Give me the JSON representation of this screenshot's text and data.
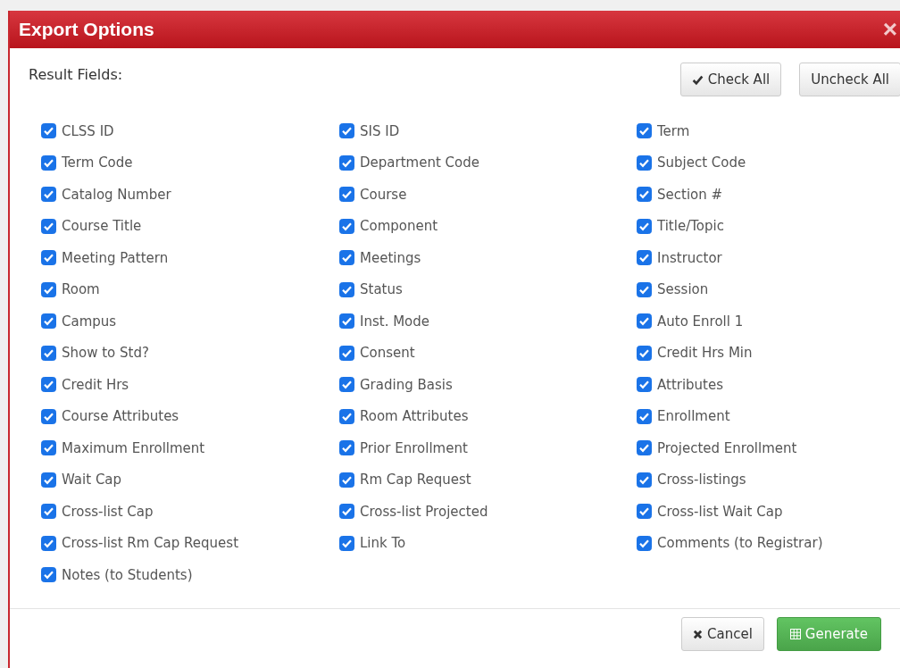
{
  "dialog": {
    "title": "Export Options",
    "close": "×"
  },
  "section_label": "Result Fields:",
  "top_buttons": [
    {
      "kind": "check",
      "label": "Check All"
    },
    {
      "kind": "plain",
      "label": "Uncheck All"
    }
  ],
  "fields": [
    {
      "label": "CLSS ID",
      "checked": true
    },
    {
      "label": "SIS ID",
      "checked": true
    },
    {
      "label": "Term",
      "checked": true
    },
    {
      "label": "Term Code",
      "checked": true
    },
    {
      "label": "Department Code",
      "checked": true
    },
    {
      "label": "Subject Code",
      "checked": true
    },
    {
      "label": "Catalog Number",
      "checked": true
    },
    {
      "label": "Course",
      "checked": true
    },
    {
      "label": "Section #",
      "checked": true
    },
    {
      "label": "Course Title",
      "checked": true
    },
    {
      "label": "Component",
      "checked": true
    },
    {
      "label": "Title/Topic",
      "checked": true
    },
    {
      "label": "Meeting Pattern",
      "checked": true
    },
    {
      "label": "Meetings",
      "checked": true
    },
    {
      "label": "Instructor",
      "checked": true
    },
    {
      "label": "Room",
      "checked": true
    },
    {
      "label": "Status",
      "checked": true
    },
    {
      "label": "Session",
      "checked": true
    },
    {
      "label": "Campus",
      "checked": true
    },
    {
      "label": "Inst. Mode",
      "checked": true
    },
    {
      "label": "Auto Enroll 1",
      "checked": true
    },
    {
      "label": "Show to Std?",
      "checked": true
    },
    {
      "label": "Consent",
      "checked": true
    },
    {
      "label": "Credit Hrs Min",
      "checked": true
    },
    {
      "label": "Credit Hrs",
      "checked": true
    },
    {
      "label": "Grading Basis",
      "checked": true
    },
    {
      "label": "Attributes",
      "checked": true
    },
    {
      "label": "Course Attributes",
      "checked": true
    },
    {
      "label": "Room Attributes",
      "checked": true
    },
    {
      "label": "Enrollment",
      "checked": true
    },
    {
      "label": "Maximum Enrollment",
      "checked": true
    },
    {
      "label": "Prior Enrollment",
      "checked": true
    },
    {
      "label": "Projected Enrollment",
      "checked": true
    },
    {
      "label": "Wait Cap",
      "checked": true
    },
    {
      "label": "Rm Cap Request",
      "checked": true
    },
    {
      "label": "Cross-listings",
      "checked": true
    },
    {
      "label": "Cross-list Cap",
      "checked": true
    },
    {
      "label": "Cross-list Projected",
      "checked": true
    },
    {
      "label": "Cross-list Wait Cap",
      "checked": true
    },
    {
      "label": "Cross-list Rm Cap Request",
      "checked": true
    },
    {
      "label": "Link To",
      "checked": true
    },
    {
      "label": "Comments (to Registrar)",
      "checked": true
    },
    {
      "label": "Notes (to Students)",
      "checked": true
    }
  ],
  "footer_buttons": [
    {
      "kind": "cancel",
      "label": "Cancel"
    },
    {
      "kind": "generate",
      "label": "Generate"
    }
  ]
}
